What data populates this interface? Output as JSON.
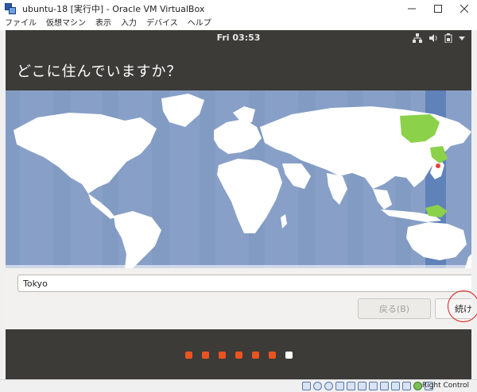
{
  "window": {
    "title": "ubuntu-18 [実行中] - Oracle VM VirtualBox",
    "controls": [
      "minimize",
      "maximize",
      "close"
    ]
  },
  "menu": {
    "items": [
      "ファイル",
      "仮想マシン",
      "表示",
      "入力",
      "デバイス",
      "ヘルプ"
    ]
  },
  "topbar": {
    "clock": "Fri 03:53",
    "tray_icons": [
      "network-icon",
      "volume-icon",
      "battery-icon",
      "dropdown-icon"
    ]
  },
  "installer": {
    "heading": "どこに住んでいますか？",
    "location_value": "Tokyo",
    "back_label": "戻る(B)",
    "continue_label": "続け",
    "progress": {
      "total": 7,
      "current": 7
    },
    "colors": {
      "header_bg": "#3c3b37",
      "map_water": "#88a0c8",
      "map_land": "#ffffff",
      "timezone_highlight": "#5f82b8",
      "selected_region": "#8bd14a",
      "progress_done": "#e95420",
      "progress_current": "#ffffff",
      "annotation_circle": "#e01818"
    }
  },
  "statusbar": {
    "host_key": "Right Control"
  }
}
